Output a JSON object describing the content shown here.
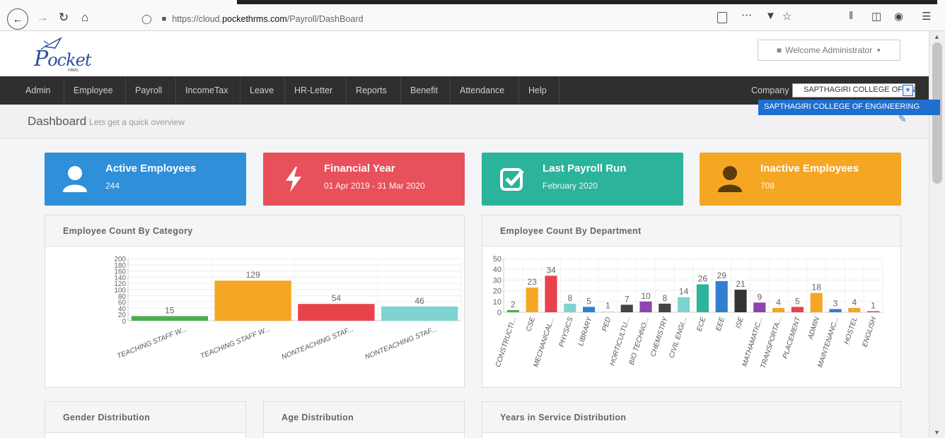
{
  "browser": {
    "url_prefix": "https://cloud.",
    "url_domain": "pockethrms.com",
    "url_path": "/Payroll/DashBoard"
  },
  "header": {
    "logo_text": "ocket",
    "logo_p": "P",
    "logo_sub": "HRMS",
    "welcome": "Welcome Administrator"
  },
  "nav": {
    "items": [
      "Admin",
      "Employee",
      "Payroll",
      "IncomeTax",
      "Leave",
      "HR-Letter",
      "Reports",
      "Benefit",
      "Attendance",
      "Help"
    ],
    "company_label": "Company",
    "company_selected": "SAPTHAGIRI COLLEGE OF ENGINEERING",
    "company_option": "SAPTHAGIRI COLLEGE OF ENGINEERING"
  },
  "page": {
    "title": "Dashboard",
    "subtitle": "Lets get a quick overview"
  },
  "stats": [
    {
      "title": "Active Employees",
      "value": "244",
      "color": "#2f8fd8",
      "icon": "user-icon"
    },
    {
      "title": "Financial Year",
      "value": "01 Apr 2019 - 31 Mar 2020",
      "color": "#e8505b",
      "icon": "bolt-icon"
    },
    {
      "title": "Last Payroll Run",
      "value": "February 2020",
      "color": "#2bb39c",
      "icon": "check-square-icon"
    },
    {
      "title": "Inactive Employees",
      "value": "708",
      "color": "#f5a623",
      "icon": "user-icon"
    }
  ],
  "panels": {
    "category": "Employee Count By Category",
    "department": "Employee Count By Department",
    "gender": "Gender Distribution",
    "age": "Age Distribution",
    "service": "Years in Service Distribution"
  },
  "chart_data": [
    {
      "type": "bar",
      "title": "Employee Count By Category",
      "categories": [
        "TEACHING STAFF W...",
        "TEACHING STAFF W...",
        "NONTEACHING STAF...",
        "NONTEACHING STAF..."
      ],
      "values": [
        15,
        129,
        54,
        46
      ],
      "colors": [
        "#4cae4c",
        "#f5a623",
        "#e8434b",
        "#7fd3d0"
      ],
      "ylim": [
        0,
        200
      ],
      "yticks": [
        0,
        20,
        40,
        60,
        80,
        100,
        120,
        140,
        160,
        180,
        200
      ]
    },
    {
      "type": "bar",
      "title": "Employee Count By Department",
      "categories": [
        "CONSTRUCTI...",
        "CSE",
        "MECHANICAL...",
        "PHYSICS",
        "LIBRARY",
        "PED",
        "HORTICULTU...",
        "BIO TECHNO...",
        "CHEMISTRY",
        "CIVIL ENGI...",
        "ECE",
        "EEE",
        "ISE",
        "MATHAMATIC...",
        "TRANSPORTA...",
        "PLACEMENT",
        "ADMIN",
        "MAINTENANC...",
        "HOSTEL",
        "ENGLISH"
      ],
      "values": [
        2,
        23,
        34,
        8,
        5,
        1,
        7,
        10,
        8,
        14,
        26,
        29,
        21,
        9,
        4,
        5,
        18,
        3,
        4,
        1
      ],
      "colors": [
        "#4cae4c",
        "#f5a623",
        "#e8434b",
        "#7fd3d0",
        "#2f7fd0",
        "#e0e0e0",
        "#444",
        "#8e44ad",
        "#444",
        "#7fd3d0",
        "#2bb39c",
        "#2f7fd0",
        "#333",
        "#8e44ad",
        "#f5a623",
        "#e8434b",
        "#f5a623",
        "#2f7fd0",
        "#f5a623",
        "#e8434b"
      ],
      "ylim": [
        0,
        50
      ],
      "yticks": [
        0,
        10,
        20,
        30,
        40,
        50
      ]
    }
  ]
}
